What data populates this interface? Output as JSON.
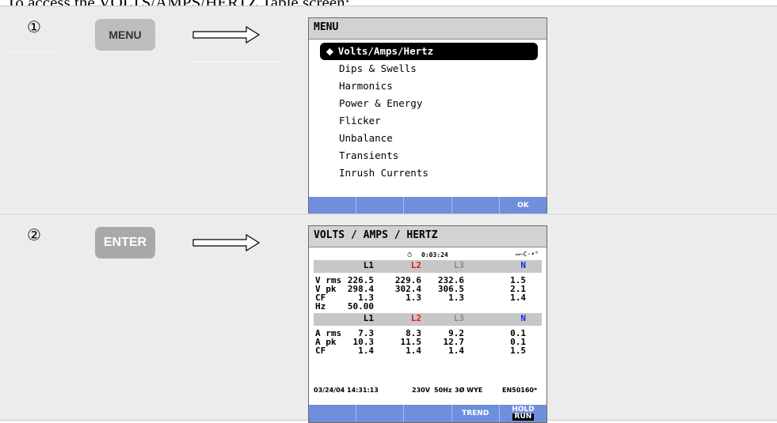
{
  "heading": "To access the VOLTS/AMPS/HERTZ Table screen:",
  "steps": [
    {
      "number": "①",
      "key_label": "MENU",
      "screen": {
        "title": "MENU",
        "items": [
          "Volts/Amps/Hertz",
          "Dips & Swells",
          "Harmonics",
          "Power & Energy",
          "Flicker",
          "Unbalance",
          "Transients",
          "Inrush Currents"
        ],
        "selected_marker": "♦",
        "softkeys": [
          "",
          "",
          "",
          "",
          "OK"
        ]
      }
    },
    {
      "number": "②",
      "key_label": "ENTER",
      "screen": {
        "title": "VOLTS / AMPS / HERTZ",
        "timer": "0:03:24",
        "battery_indicator": "▭−C·•°",
        "volt_header": [
          "",
          "L1",
          "L2",
          "L3",
          "N"
        ],
        "volt_rows": [
          [
            "V rms",
            "226.5",
            "229.6",
            "232.6",
            "1.5"
          ],
          [
            "V pk",
            "298.4",
            "302.4",
            "306.5",
            "2.1"
          ],
          [
            "CF",
            "1.3",
            "1.3",
            "1.3",
            "1.4"
          ],
          [
            "Hz",
            "50.00",
            "",
            "",
            ""
          ]
        ],
        "amp_header": [
          "",
          "L1",
          "L2",
          "L3",
          "N"
        ],
        "amp_rows": [
          [
            "A rms",
            "7.3",
            "8.3",
            "9.2",
            "0.1"
          ],
          [
            "A pk",
            "10.3",
            "11.5",
            "12.7",
            "0.1"
          ],
          [
            "CF",
            "1.4",
            "1.4",
            "1.4",
            "1.5"
          ]
        ],
        "status": {
          "date_time": "03/24/04  14:31:13",
          "voltage": "230V",
          "frequency": "50Hz",
          "config": "3Ø WYE",
          "standard": "EN50160*"
        },
        "softkeys": [
          "",
          "",
          "",
          "TREND",
          "HOLD"
        ],
        "softkey_run": "RUN"
      }
    }
  ],
  "colors": {
    "softkey_blue": "#6e8fdc",
    "l2_red": "#e21a1a",
    "l3_gray": "#8a8a8a",
    "n_blue": "#1a2be2"
  }
}
